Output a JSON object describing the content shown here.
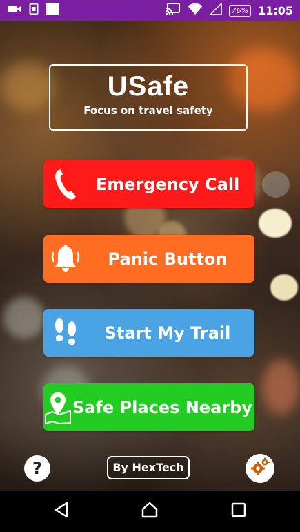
{
  "status_bar": {
    "time": "11:05",
    "battery": "76%",
    "background": "#7b1fa2"
  },
  "app": {
    "title": "USafe",
    "subtitle": "Focus on travel safety"
  },
  "buttons": {
    "emergency": {
      "label": "Emergency Call",
      "icon": "phone-icon",
      "color": "#ff1a1a"
    },
    "panic": {
      "label": "Panic Button",
      "icon": "bell-icon",
      "color": "#fe6d21"
    },
    "trail": {
      "label": "Start My Trail",
      "icon": "footprints-icon",
      "color": "#4aa3e3"
    },
    "safe_places": {
      "label": "Safe Places Nearby",
      "icon": "map-pin-icon",
      "color": "#22cc22"
    }
  },
  "footer": {
    "help": "?",
    "credit": "By HexTech",
    "settings_icon": "gears-icon"
  },
  "nav_bar": {
    "back_icon": "back-triangle-icon",
    "home_icon": "home-icon",
    "recents_icon": "recents-square-icon"
  }
}
